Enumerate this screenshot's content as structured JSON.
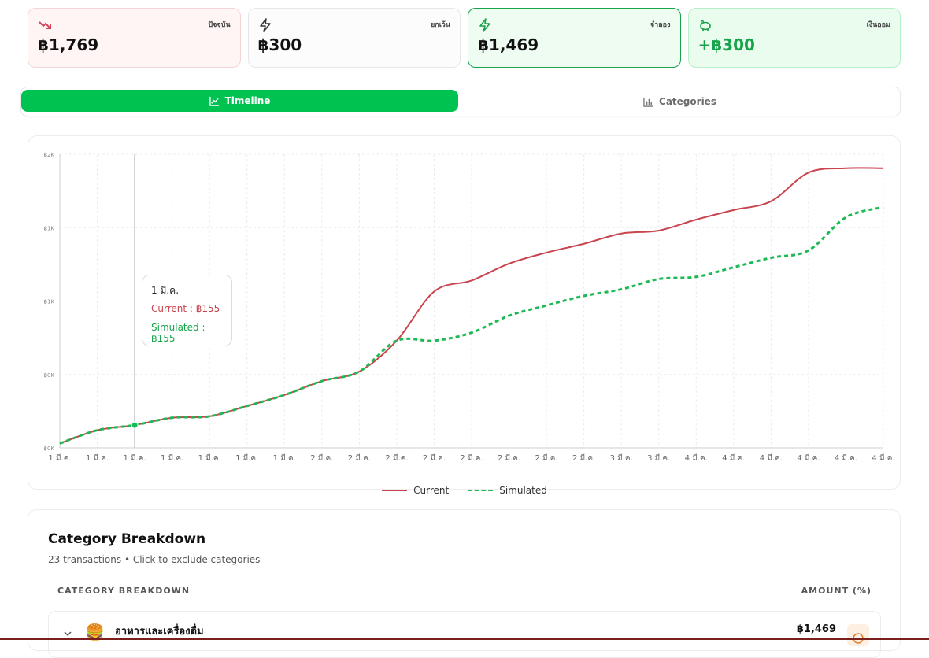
{
  "summary": {
    "current": {
      "label": "ปัจจุบัน",
      "value": "฿1,769",
      "icon": "trending-down-icon"
    },
    "excluded": {
      "label": "ยกเว้น",
      "value": "฿300",
      "icon": "lightning-icon"
    },
    "simulated": {
      "label": "จำลอง",
      "value": "฿1,469",
      "icon": "lightning-icon"
    },
    "savings": {
      "label": "เงินออม",
      "value": "+฿300",
      "icon": "piggy-bank-icon"
    }
  },
  "tabs": [
    {
      "label": "Timeline",
      "active": true,
      "icon": "line-chart-icon"
    },
    {
      "label": "Categories",
      "active": false,
      "icon": "bar-chart-icon"
    }
  ],
  "tooltip": {
    "date": "1 มี.ค.",
    "current": "Current : ฿155",
    "simulated": "Simulated : ฿155"
  },
  "legend": {
    "current": "Current",
    "simulated": "Simulated"
  },
  "chart_data": {
    "type": "line",
    "x": [
      "1 มี.ค.",
      "1 มี.ค.",
      "1 มี.ค.",
      "1 มี.ค.",
      "1 มี.ค.",
      "1 มี.ค.",
      "1 มี.ค.",
      "2 มี.ค.",
      "2 มี.ค.",
      "2 มี.ค.",
      "2 มี.ค.",
      "2 มี.ค.",
      "2 มี.ค.",
      "2 มี.ค.",
      "2 มี.ค.",
      "3 มี.ค.",
      "3 มี.ค.",
      "4 มี.ค.",
      "4 มี.ค.",
      "4 มี.ค.",
      "4 มี.ค.",
      "4 มี.ค.",
      "4 มี.ค."
    ],
    "y_ticks": [
      "฿0K",
      "฿0K",
      "฿1K",
      "฿1K",
      "฿2K"
    ],
    "ylim": [
      0,
      2000
    ],
    "series": [
      {
        "name": "Current",
        "color": "#c8454f",
        "values": [
          30,
          120,
          155,
          205,
          215,
          285,
          360,
          455,
          520,
          730,
          1065,
          1140,
          1255,
          1330,
          1390,
          1460,
          1480,
          1555,
          1620,
          1680,
          1875,
          1905,
          1905
        ]
      },
      {
        "name": "Simulated",
        "color": "#1db954",
        "values": [
          30,
          120,
          155,
          205,
          215,
          285,
          360,
          455,
          520,
          730,
          730,
          785,
          900,
          970,
          1035,
          1080,
          1150,
          1165,
          1230,
          1295,
          1345,
          1570,
          1640
        ]
      }
    ],
    "grid": true,
    "legend": "bottom",
    "hover_index": 2
  },
  "categories": {
    "title": "Category Breakdown",
    "subtitle": "23 transactions • Click to exclude categories",
    "col_left": "CATEGORY BREAKDOWN",
    "col_right": "AMOUNT (%)",
    "rows": [
      {
        "emoji": "🍔",
        "name": "อาหารและเครื่องดื่ม",
        "amount": "฿1,469",
        "icon": "minus-circle-icon"
      }
    ]
  }
}
